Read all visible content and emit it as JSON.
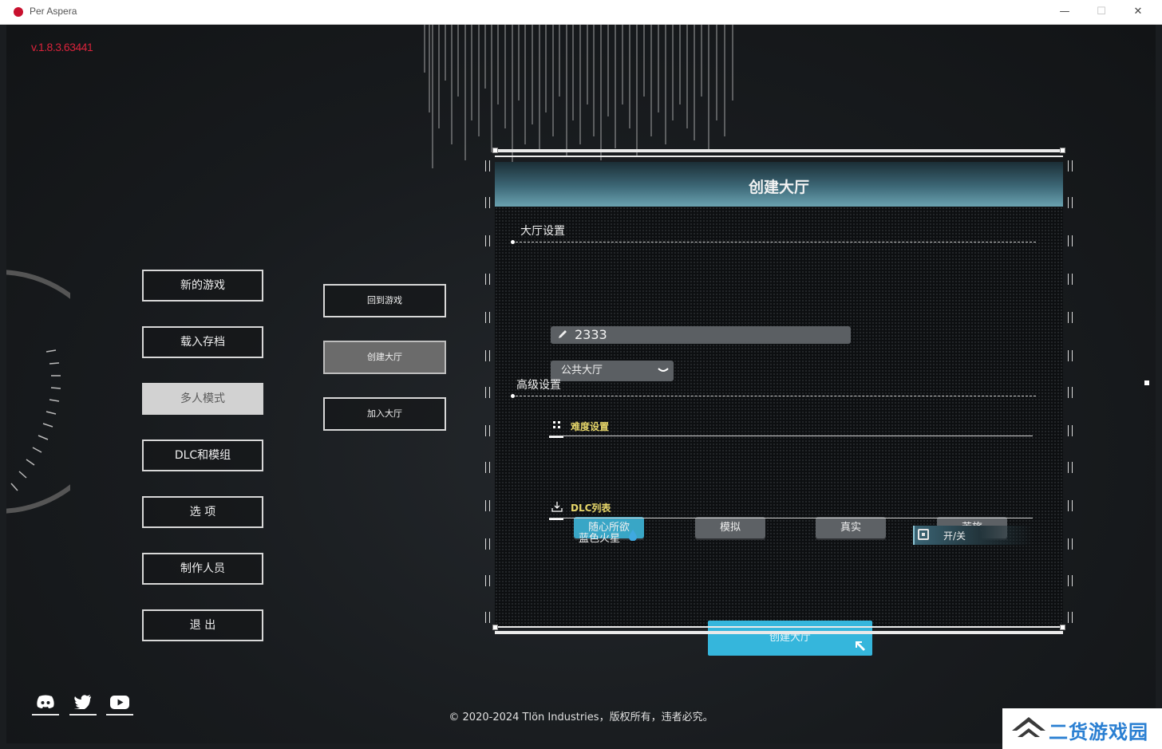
{
  "window": {
    "title": "Per Aspera",
    "controls": {
      "minimize": "—",
      "maximize": "☐",
      "close": "✕"
    }
  },
  "version": "v.1.8.3.63441",
  "main_menu": {
    "items": [
      {
        "label": "新的游戏",
        "active": false
      },
      {
        "label": "载入存档",
        "active": false
      },
      {
        "label": "多人模式",
        "active": true
      },
      {
        "label": "DLC和模组",
        "active": false
      },
      {
        "label": "选 项",
        "active": false
      },
      {
        "label": "制作人员",
        "active": false
      },
      {
        "label": "退 出",
        "active": false
      }
    ]
  },
  "multiplayer_menu": {
    "items": [
      {
        "label": "回到游戏",
        "active": false
      },
      {
        "label": "创建大厅",
        "active": true
      },
      {
        "label": "加入大厅",
        "active": false
      }
    ]
  },
  "dialog": {
    "title": "创建大厅",
    "lobby_settings": {
      "heading": "大厅设置",
      "name_value": "2333",
      "visibility": {
        "selected": "公共大厅"
      }
    },
    "advanced_settings": {
      "heading": "高级设置",
      "difficulty": {
        "heading": "难度设置",
        "options": [
          {
            "label": "随心所欲",
            "active": true
          },
          {
            "label": "模拟",
            "active": false
          },
          {
            "label": "真实",
            "active": false
          },
          {
            "label": "苦旅",
            "active": false
          }
        ]
      },
      "dlc": {
        "heading": "DLC列表",
        "items": [
          {
            "name": "蓝色火星",
            "toggle_label": "开/关"
          }
        ]
      }
    },
    "create_button": "创建大厅"
  },
  "social_icons": [
    "discord-icon",
    "twitter-icon",
    "youtube-icon"
  ],
  "copyright": "© 2020-2024 Tlön Industries，版权所有，违者必究。",
  "watermark": "二货游戏园",
  "colors": {
    "version_red": "#d9233b",
    "accent_blue": "#39a6c6",
    "create_button": "#35b6dc",
    "subheading_yellow": "#e7d76a",
    "watermark_blue": "#2a7fd2"
  }
}
